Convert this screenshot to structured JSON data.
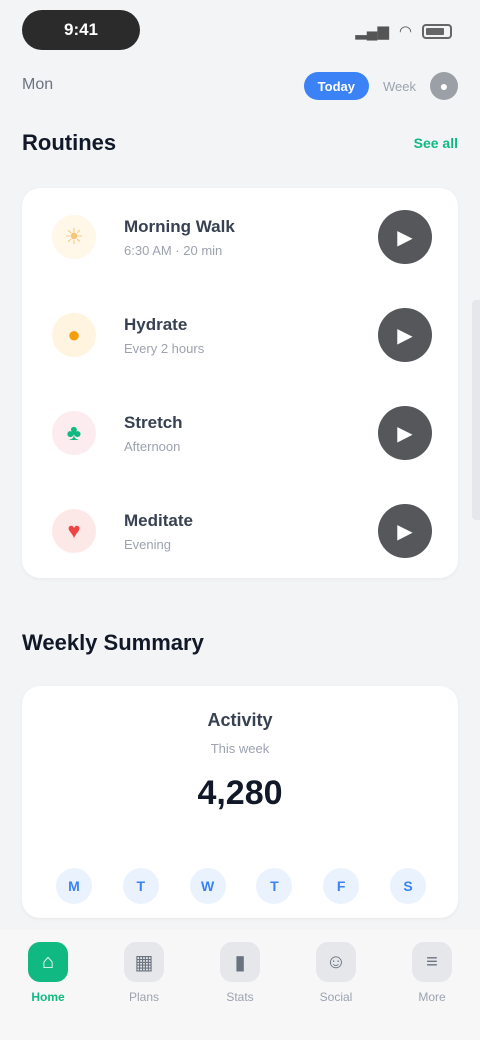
{
  "status_bar": {
    "time": "9:41",
    "signal_icon": "signal-icon",
    "wifi_icon": "wifi-icon",
    "battery_icon": "battery-icon"
  },
  "header": {
    "left_text": "Mon",
    "segment_active": "Today",
    "segment_inactive": "Week",
    "profile_icon": "user-icon"
  },
  "section_routines": {
    "title": "Routines",
    "link": "See all"
  },
  "routines": [
    {
      "name": "Morning Walk",
      "sub": "6:30 AM · 20 min",
      "icon": "sun-icon",
      "color": "#f3c77a",
      "bg": "#fff7e8"
    },
    {
      "name": "Hydrate",
      "sub": "Every 2 hours",
      "icon": "drop-icon",
      "color": "#f59e0b",
      "bg": "#fff4e0"
    },
    {
      "name": "Stretch",
      "sub": "Afternoon",
      "icon": "leaf-icon",
      "color": "#10b981",
      "bg": "#fdecef"
    },
    {
      "name": "Meditate",
      "sub": "Evening",
      "icon": "heart-icon",
      "color": "#ef4444",
      "bg": "#fde8e8"
    }
  ],
  "section_summary": {
    "title": "Weekly Summary"
  },
  "summary": {
    "title": "Activity",
    "sub": "This week",
    "value": "4,280",
    "days": [
      "M",
      "T",
      "W",
      "T",
      "F",
      "S"
    ]
  },
  "tabs": [
    {
      "label": "Home",
      "icon": "home-icon",
      "active": true
    },
    {
      "label": "Plans",
      "icon": "calendar-icon",
      "active": false
    },
    {
      "label": "Stats",
      "icon": "chart-icon",
      "active": false
    },
    {
      "label": "Social",
      "icon": "people-icon",
      "active": false
    },
    {
      "label": "More",
      "icon": "menu-icon",
      "active": false
    }
  ],
  "colors": {
    "accent": "#10b981",
    "blue": "#3b82f6",
    "action_button": "#55575b",
    "background": "#f3f4f6"
  }
}
